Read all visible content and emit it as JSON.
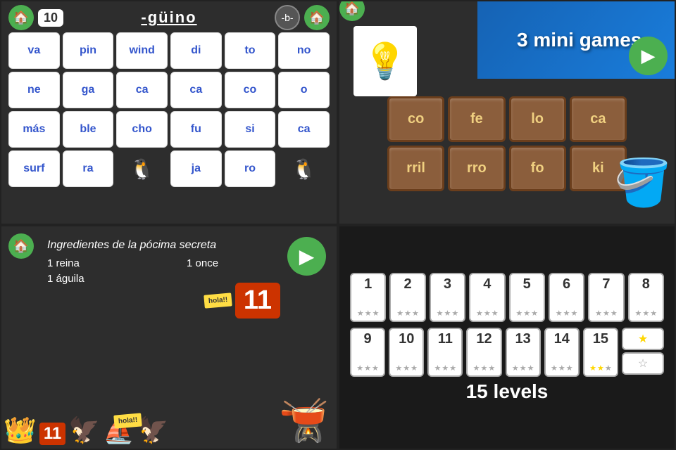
{
  "topLeft": {
    "score": "10",
    "word": "-güino",
    "tiles": [
      "va",
      "pin",
      "wind",
      "di",
      "to",
      "no",
      "ne",
      "ga",
      "ca",
      "ca",
      "co",
      "o",
      "más",
      "ble",
      "cho",
      "fu",
      "si",
      "ca",
      "surf",
      "ra",
      "🐧",
      "ja",
      "ro",
      "🐧"
    ],
    "penguinIndices": [
      20,
      23
    ]
  },
  "topRight": {
    "lightbulbIcon": "💡",
    "woodTiles": [
      "co",
      "fe",
      "lo",
      "ca",
      "rril",
      "rro",
      "fo",
      "ki"
    ],
    "answerBlanks": 2
  },
  "banner": {
    "line1": "3 mini games",
    "arrowIcon": "▶"
  },
  "bottomLeft": {
    "title": "Ingredientes de la pócima secreta",
    "items": [
      "1 reina",
      "1 once",
      "1 águila"
    ],
    "stickyText": "hola!!",
    "number": "11",
    "arrowIcon": "▶"
  },
  "bottomRight": {
    "levels": [
      {
        "num": "1",
        "stars": [
          false,
          false,
          false
        ]
      },
      {
        "num": "2",
        "stars": [
          false,
          false,
          false
        ]
      },
      {
        "num": "3",
        "stars": [
          false,
          false,
          false
        ]
      },
      {
        "num": "4",
        "stars": [
          false,
          false,
          false
        ]
      },
      {
        "num": "5",
        "stars": [
          false,
          false,
          false
        ]
      },
      {
        "num": "6",
        "stars": [
          false,
          false,
          false
        ]
      },
      {
        "num": "7",
        "stars": [
          false,
          false,
          false
        ]
      },
      {
        "num": "8",
        "stars": [
          false,
          false,
          false
        ]
      },
      {
        "num": "9",
        "stars": [
          false,
          false,
          false
        ]
      },
      {
        "num": "10",
        "stars": [
          false,
          false,
          false
        ]
      },
      {
        "num": "11",
        "stars": [
          false,
          false,
          false
        ]
      },
      {
        "num": "12",
        "stars": [
          false,
          false,
          false
        ]
      },
      {
        "num": "13",
        "stars": [
          false,
          false,
          false
        ]
      },
      {
        "num": "14",
        "stars": [
          false,
          false,
          false
        ]
      },
      {
        "num": "15",
        "stars": [
          true,
          true,
          false
        ]
      }
    ],
    "label": "15 levels"
  }
}
